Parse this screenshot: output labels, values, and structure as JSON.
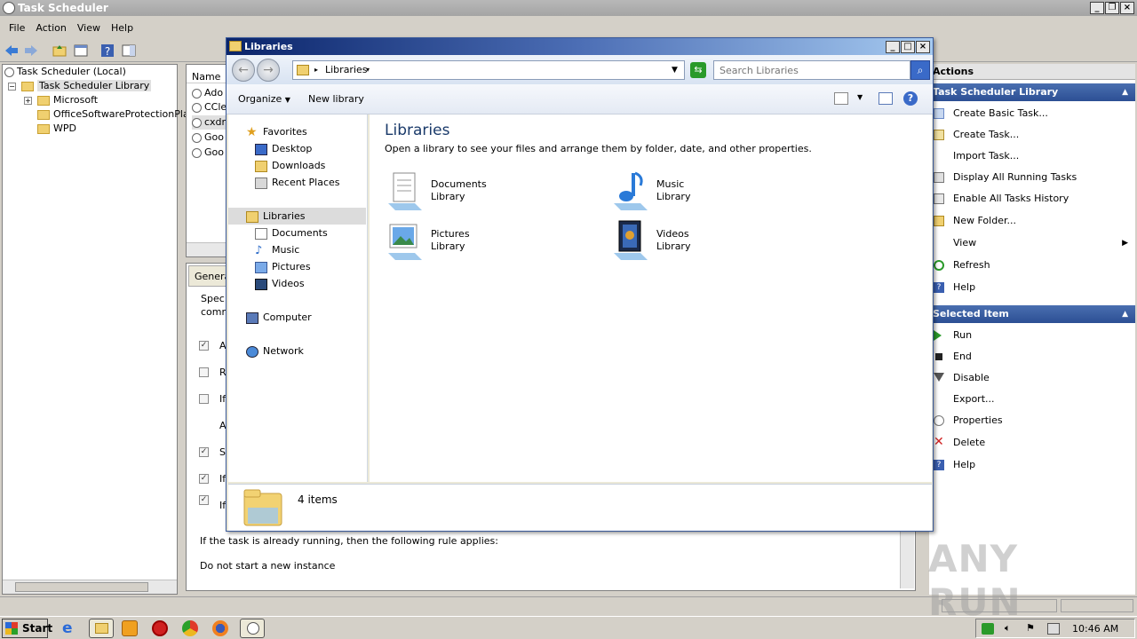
{
  "app": {
    "title": "Task Scheduler",
    "menu": [
      "File",
      "Action",
      "View",
      "Help"
    ]
  },
  "tree": {
    "root": "Task Scheduler (Local)",
    "library": "Task Scheduler Library",
    "folders": [
      "Microsoft",
      "OfficeSoftwareProtectionPla",
      "WPD"
    ]
  },
  "task_list": {
    "header": "Name",
    "rows": [
      "Ado",
      "CCle",
      "cxdr",
      "Goo",
      "Goo"
    ]
  },
  "task_detail": {
    "tab": "Genera",
    "desc_line1": "Spec",
    "desc_line2": "comr",
    "option_letters": [
      "A",
      "R",
      "If",
      "A",
      "S",
      "If",
      "If"
    ],
    "running_rule_label": "If the task is already running, then the following rule applies:",
    "running_rule_value": "Do not start a new instance"
  },
  "actions": {
    "header": "Actions",
    "library_section": "Task Scheduler Library",
    "library_items": [
      "Create Basic Task...",
      "Create Task...",
      "Import Task...",
      "Display All Running Tasks",
      "Enable All Tasks History",
      "New Folder...",
      "View",
      "Refresh",
      "Help"
    ],
    "selected_section": "Selected Item",
    "selected_items": [
      "Run",
      "End",
      "Disable",
      "Export...",
      "Properties",
      "Delete",
      "Help"
    ]
  },
  "libraries_window": {
    "title": "Libraries",
    "address": "Libraries",
    "search_placeholder": "Search Libraries",
    "commands": {
      "organize": "Organize",
      "new_library": "New library"
    },
    "nav": {
      "favorites": "Favorites",
      "favorites_items": [
        "Desktop",
        "Downloads",
        "Recent Places"
      ],
      "libraries": "Libraries",
      "libraries_items": [
        "Documents",
        "Music",
        "Pictures",
        "Videos"
      ],
      "computer": "Computer",
      "network": "Network"
    },
    "heading": "Libraries",
    "subheading": "Open a library to see your files and arrange them by folder, date, and other properties.",
    "items": [
      {
        "name": "Documents",
        "type": "Library"
      },
      {
        "name": "Music",
        "type": "Library"
      },
      {
        "name": "Pictures",
        "type": "Library"
      },
      {
        "name": "Videos",
        "type": "Library"
      }
    ],
    "status": "4 items"
  },
  "taskbar": {
    "start": "Start",
    "clock": "10:46 AM"
  },
  "watermark": "ANY RUN"
}
